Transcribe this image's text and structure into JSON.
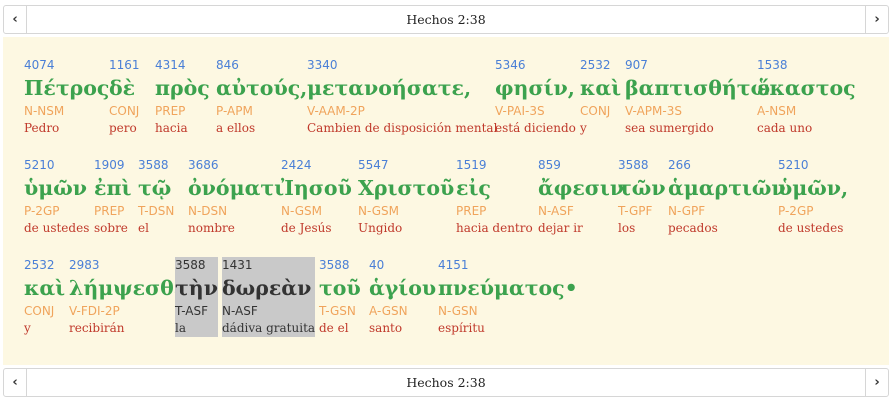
{
  "nav": {
    "title": "Hechos 2:38",
    "prev_icon": "‹",
    "next_icon": "›"
  },
  "lines": [
    [
      {
        "num": "4074",
        "greek": "Πέτρος",
        "morph": "N-NSM",
        "gloss": "Pedro"
      },
      {
        "num": "1161",
        "greek": "δὲ",
        "morph": "CONJ",
        "gloss": "pero"
      },
      {
        "num": "4314",
        "greek": "πρὸς",
        "morph": "PREP",
        "gloss": "hacia"
      },
      {
        "num": "846",
        "greek": "αὐτούς,",
        "morph": "P-APM",
        "gloss": "a ellos"
      },
      {
        "num": "3340",
        "greek": "μετανοήσατε,",
        "morph": "V-AAM-2P",
        "gloss": "Cambien de disposición mental"
      },
      {
        "num": "5346",
        "greek": "φησίν,",
        "morph": "V-PAI-3S",
        "gloss": "está diciendo"
      },
      {
        "num": "2532",
        "greek": "καὶ",
        "morph": "CONJ",
        "gloss": "y"
      },
      {
        "num": "907",
        "greek": "βαπτισθήτω",
        "morph": "V-APM-3S",
        "gloss": "sea sumergido"
      },
      {
        "num": "1538",
        "greek": "ἕκαστος",
        "morph": "A-NSM",
        "gloss": "cada uno"
      }
    ],
    [
      {
        "num": "5210",
        "greek": "ὑμῶν",
        "morph": "P-2GP",
        "gloss": "de ustedes"
      },
      {
        "num": "1909",
        "greek": "ἐπὶ",
        "morph": "PREP",
        "gloss": "sobre"
      },
      {
        "num": "3588",
        "greek": "τῷ",
        "morph": "T-DSN",
        "gloss": "el"
      },
      {
        "num": "3686",
        "greek": "ὀνόματι",
        "morph": "N-DSN",
        "gloss": "nombre"
      },
      {
        "num": "2424",
        "greek": "Ἰησοῦ",
        "morph": "N-GSM",
        "gloss": "de Jesús"
      },
      {
        "num": "5547",
        "greek": "Χριστοῦ",
        "morph": "N-GSM",
        "gloss": "Ungido"
      },
      {
        "num": "1519",
        "greek": "εἰς",
        "morph": "PREP",
        "gloss": "hacia dentro"
      },
      {
        "num": "859",
        "greek": "ἄφεσιν",
        "morph": "N-ASF",
        "gloss": "dejar ir"
      },
      {
        "num": "3588",
        "greek": "τῶν",
        "morph": "T-GPF",
        "gloss": "los"
      },
      {
        "num": "266",
        "greek": "ἁμαρτιῶν",
        "morph": "N-GPF",
        "gloss": "pecados"
      },
      {
        "num": "5210",
        "greek": "ὑμῶν,",
        "morph": "P-2GP",
        "gloss": "de ustedes"
      }
    ],
    [
      {
        "num": "2532",
        "greek": "καὶ",
        "morph": "CONJ",
        "gloss": "y"
      },
      {
        "num": "2983",
        "greek": "λήμψεσθε",
        "morph": "V-FDI-2P",
        "gloss": "recibirán"
      },
      {
        "num": "3588",
        "greek": "τὴν",
        "morph": "T-ASF",
        "gloss": "la"
      },
      {
        "num": "1431",
        "greek": "δωρεὰν",
        "morph": "N-ASF",
        "gloss": "dádiva gratuita"
      },
      {
        "num": "3588",
        "greek": "τοῦ",
        "morph": "T-GSN",
        "gloss": "de el"
      },
      {
        "num": "40",
        "greek": "ἁγίου",
        "morph": "A-GSN",
        "gloss": "santo"
      },
      {
        "num": "4151",
        "greek": "πνεύματος•",
        "morph": "N-GSN",
        "gloss": "espíritu"
      }
    ]
  ]
}
